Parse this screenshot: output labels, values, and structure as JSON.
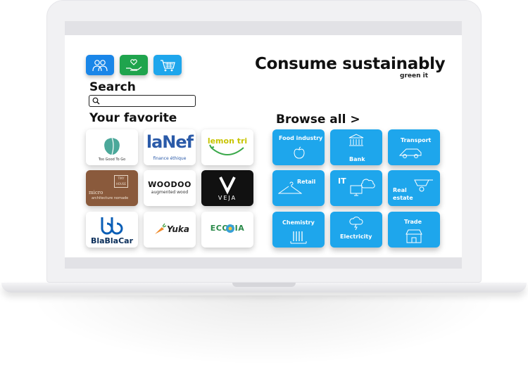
{
  "header": {
    "headline": "Consume sustainably",
    "brand": "green it"
  },
  "top_icons": [
    {
      "name": "community",
      "color": "#1a86e8"
    },
    {
      "name": "care",
      "color": "#1fa44d"
    },
    {
      "name": "shopping-cart",
      "color": "#1ea6ec"
    }
  ],
  "search": {
    "label": "Search",
    "value": "",
    "placeholder": ""
  },
  "favorites": {
    "title": "Your favorite",
    "items": [
      {
        "name": "Too Good To Go",
        "caption": "Too Good To Go"
      },
      {
        "name": "La Nef",
        "word": "laNef",
        "caption": "finance éthique"
      },
      {
        "name": "lemon tri",
        "word": "lemon tri"
      },
      {
        "name": "Tiny House micro architecture nomade",
        "caption1": "micro",
        "caption2": "architecture nomade",
        "badge": "TINY HOUSE"
      },
      {
        "name": "WOODOO",
        "word": "WOODOO",
        "caption": "augmented wood"
      },
      {
        "name": "VEJA",
        "word": "VEJA"
      },
      {
        "name": "BlaBlaCar",
        "word": "BlaBlaCar"
      },
      {
        "name": "Yuka",
        "word": "Yuka"
      },
      {
        "name": "ECOSIA",
        "word": "ECOSIA"
      }
    ]
  },
  "browse": {
    "title": "Browse all >",
    "categories": [
      {
        "label": "Food industry",
        "icon": "apple-icon"
      },
      {
        "label": "Bank",
        "icon": "bank-icon"
      },
      {
        "label": "Transport",
        "icon": "car-icon"
      },
      {
        "label": "Retail",
        "icon": "hanger-icon"
      },
      {
        "label": "IT",
        "icon": "computer-cloud-icon"
      },
      {
        "label": "Real estate",
        "label1": "Real",
        "label2": "estate",
        "icon": "wheelbarrow-icon"
      },
      {
        "label": "Chemistry",
        "icon": "test-tubes-icon"
      },
      {
        "label": "Electricity",
        "icon": "cloud-lightning-icon"
      },
      {
        "label": "Trade",
        "icon": "shop-icon"
      }
    ]
  },
  "colors": {
    "accent": "#1ea6ec",
    "dark": "#111111"
  }
}
